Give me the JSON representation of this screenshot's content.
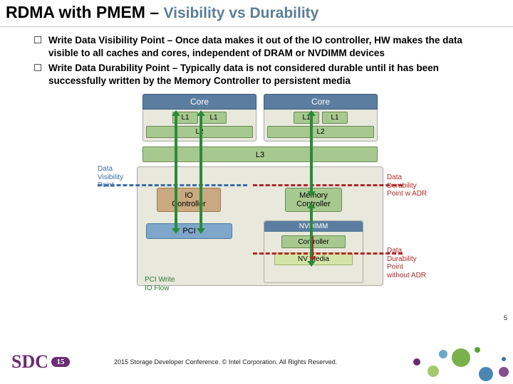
{
  "title": {
    "main": "RDMA with PMEM – ",
    "sub": "Visibility vs Durability"
  },
  "bullets": [
    "Write Data Visibility Point – Once data makes it out of the IO controller, HW makes the data visible to all caches and cores, independent of DRAM or NVDIMM devices",
    "Write Data Durability Point – Typically data is not considered durable until it has been successfully written by the Memory Controller to persistent media"
  ],
  "diagram": {
    "coreHeader": "Core",
    "l1": "L1",
    "l2": "L2",
    "l3": "L3",
    "io": "IO\nController",
    "mem": "Memory\nController",
    "pci": "PCI",
    "nvdHeader": "NVDIMM",
    "ctlr": "Controller",
    "nvm": "NV Media",
    "labels": {
      "visibility": "Data\nVisibility\nPoint",
      "dur1": "Data\nDurability\nPoint w ADR",
      "dur2": "Data\nDurability\nPoint\nwithout ADR",
      "pciFlow": "PCI Write\nIO Flow"
    }
  },
  "page": "5",
  "footer": {
    "logo": "SDC",
    "year": "15",
    "note": "2015 Storage Developer Conference. © Intel Corporation.  All Rights Reserved."
  }
}
